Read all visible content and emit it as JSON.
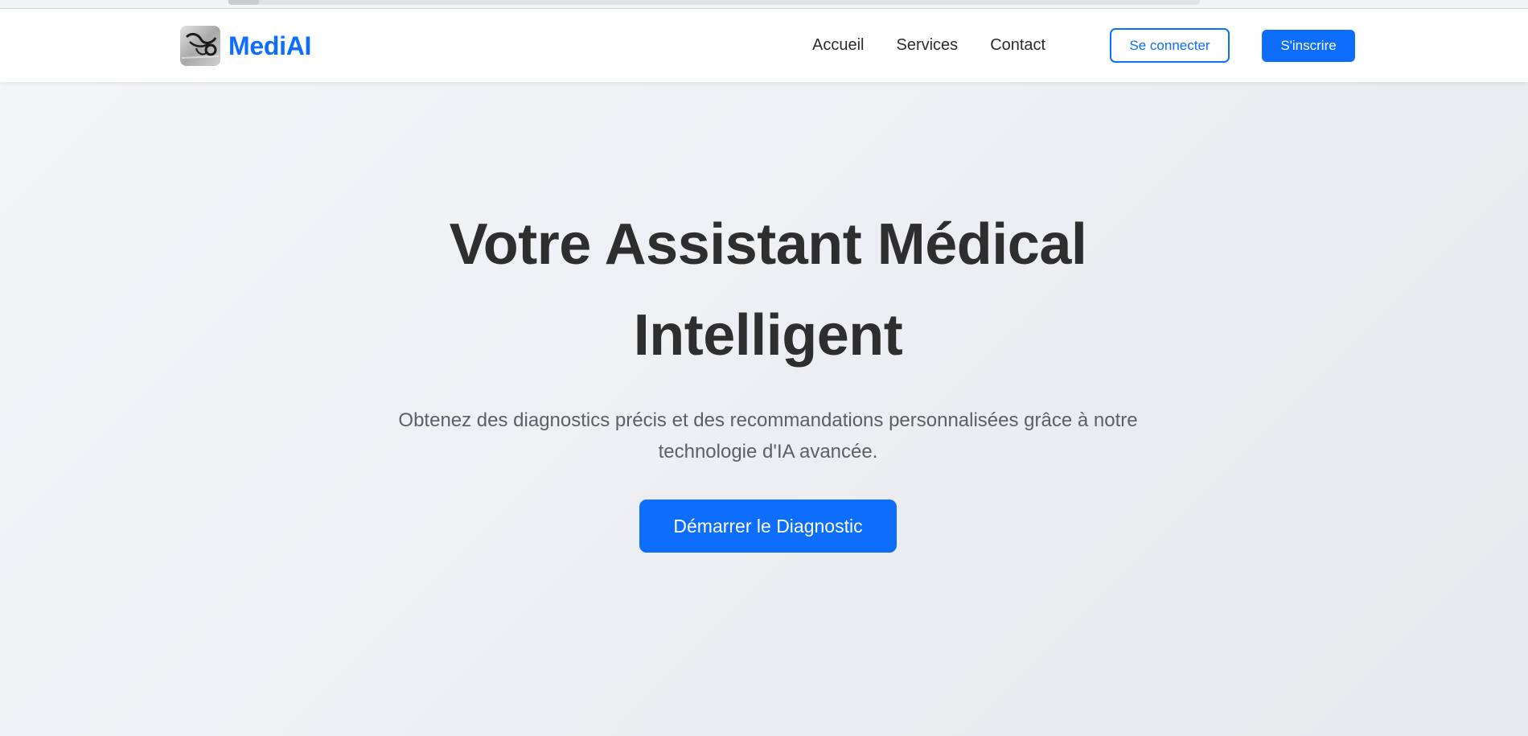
{
  "brand": {
    "name": "MediAI",
    "logo_icon": "stethoscope-logo-icon"
  },
  "nav": {
    "links": [
      "Accueil",
      "Services",
      "Contact"
    ],
    "login_label": "Se connecter",
    "signup_label": "S'inscrire"
  },
  "hero": {
    "title_line1": "Votre Assistant Médical",
    "title_line2": "Intelligent",
    "subtitle_line1": "Obtenez des diagnostics précis et des recommandations personnalisées grâce à notre",
    "subtitle_line2": "technologie d'IA avancée.",
    "cta_label": "Démarrer le Diagnostic"
  },
  "colors": {
    "primary": "#0d6efd",
    "text_dark": "#2e2e2e",
    "text_muted": "#5c5f63",
    "background": "#eef0f2"
  }
}
